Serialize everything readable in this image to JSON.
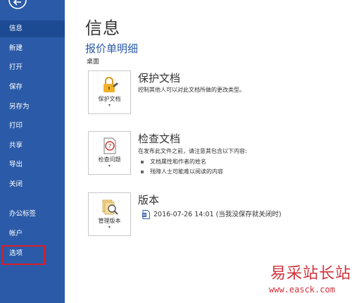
{
  "sidebar": {
    "items": [
      {
        "label": "信息",
        "active": true
      },
      {
        "label": "新建"
      },
      {
        "label": "打开"
      },
      {
        "label": "保存"
      },
      {
        "label": "另存为"
      },
      {
        "label": "打印"
      },
      {
        "label": "共享"
      },
      {
        "label": "导出"
      },
      {
        "label": "关闭"
      },
      {
        "label": "办公标签"
      },
      {
        "label": "帐户"
      },
      {
        "label": "选项",
        "highlighted": true
      }
    ],
    "colors": {
      "background": "#2b5ba8",
      "active": "#1d4b93",
      "highlight": "#d71f2a"
    }
  },
  "main": {
    "title": "信息",
    "doc_title": "报价单明细",
    "doc_location": "桌面",
    "sections": {
      "protect": {
        "tile_label": "保护文档",
        "title": "保护文档",
        "description": "控制其他人可以对此文档所做的更改类型。"
      },
      "inspect": {
        "tile_label": "检查问题",
        "title": "检查文档",
        "description": "在发布此文件之前，请注意其包含以下内容:",
        "bullets": [
          "文档属性和作者的姓名",
          "残障人士可能难以阅读的内容"
        ]
      },
      "versions": {
        "tile_label": "管理版本",
        "title": "版本",
        "entry": "2016-07-26 14:01 (当我没保存就关闭时)"
      }
    },
    "accent_color": "#2b5ba8"
  },
  "watermark": {
    "title": "易采站长站",
    "url": "www.easck.com"
  }
}
